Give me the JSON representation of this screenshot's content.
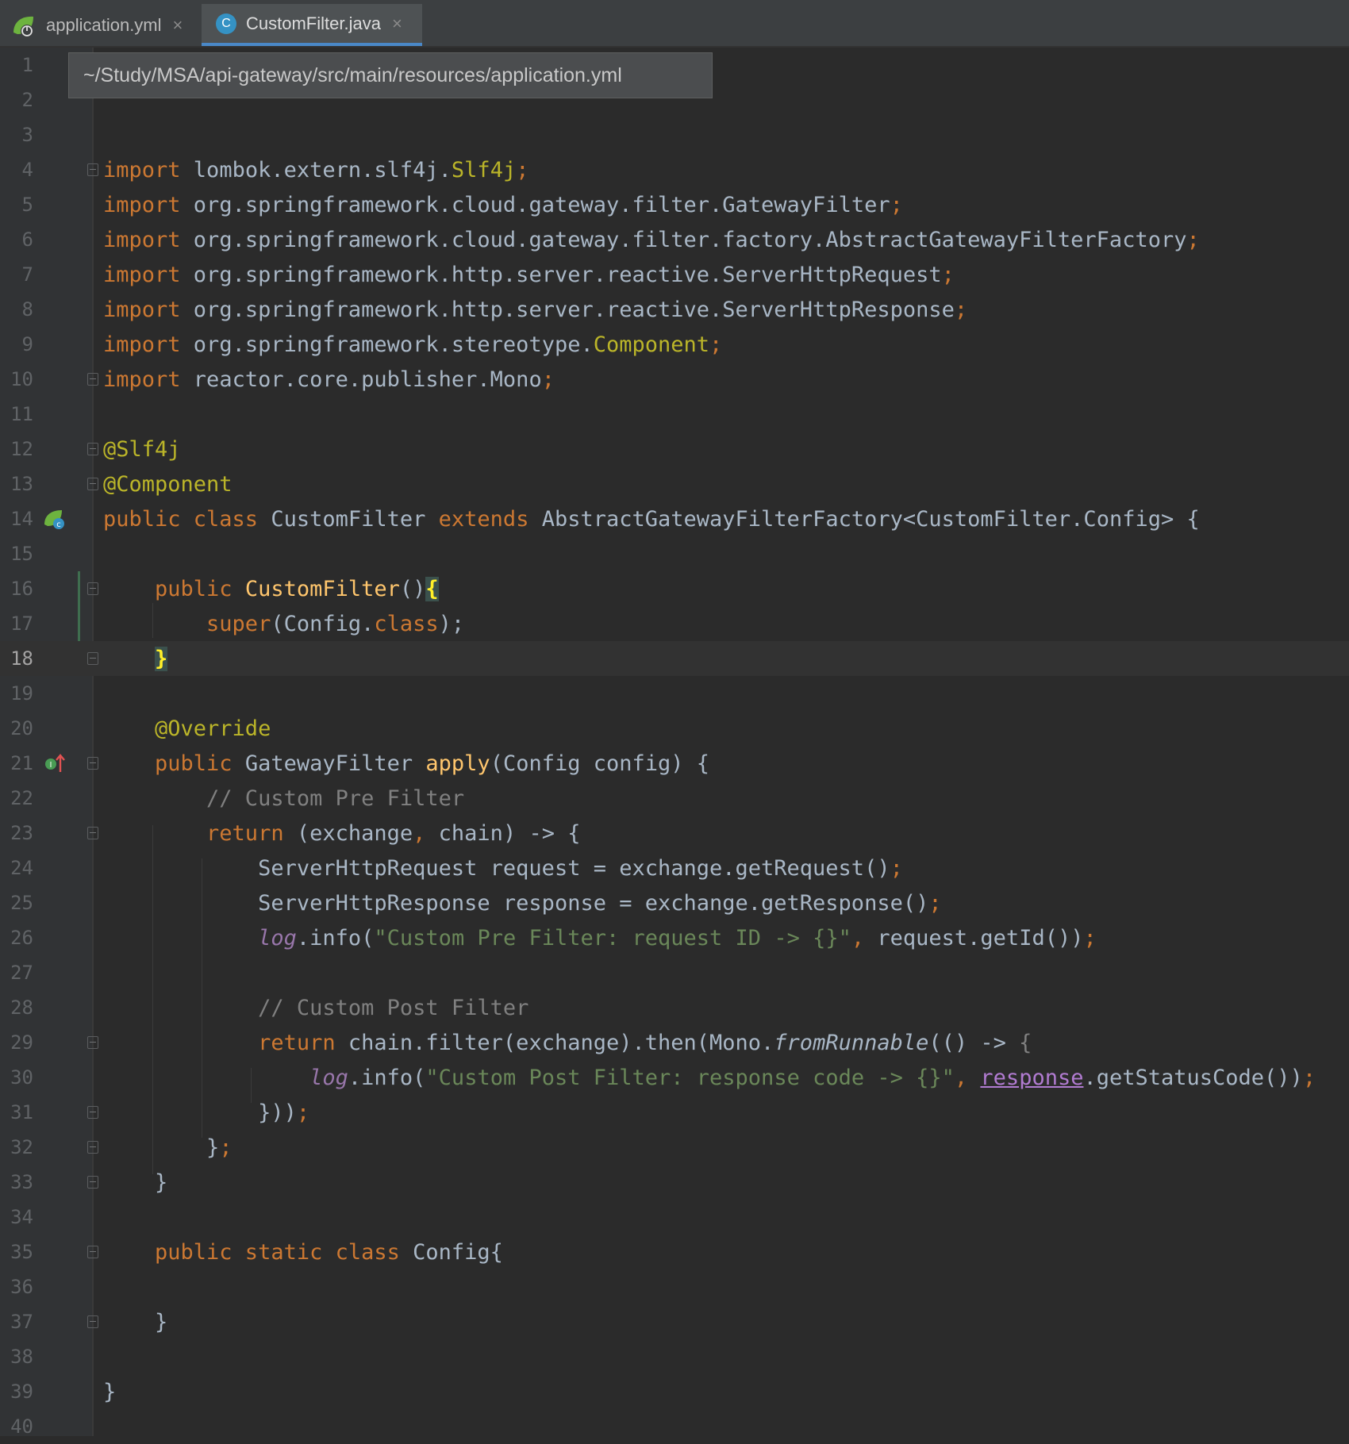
{
  "tabs": [
    {
      "label": "application.yml",
      "icon": "spring-boot-icon",
      "active": false
    },
    {
      "label": "CustomFilter.java",
      "icon": "java-class-icon",
      "active": true
    }
  ],
  "tooltip": "~/Study/MSA/api-gateway/src/main/resources/application.yml",
  "current_line": 18,
  "lines": [
    "1",
    "2",
    "3",
    "4",
    "5",
    "6",
    "7",
    "8",
    "9",
    "10",
    "11",
    "12",
    "13",
    "14",
    "15",
    "16",
    "17",
    "18",
    "19",
    "20",
    "21",
    "22",
    "23",
    "24",
    "25",
    "26",
    "27",
    "28",
    "29",
    "30",
    "31",
    "32",
    "33",
    "34",
    "35",
    "36",
    "37",
    "38",
    "39",
    "40"
  ],
  "code": {
    "l4a": "import",
    "l4b": " lombok.extern.slf4j.",
    "l4c": "Slf4j",
    "l4d": ";",
    "l5a": "import",
    "l5b": " org.springframework.cloud.gateway.filter.GatewayFilter",
    "l5d": ";",
    "l6a": "import",
    "l6b": " org.springframework.cloud.gateway.filter.factory.AbstractGatewayFilterFactory",
    "l6d": ";",
    "l7a": "import",
    "l7b": " org.springframework.http.server.reactive.ServerHttpRequest",
    "l7d": ";",
    "l8a": "import",
    "l8b": " org.springframework.http.server.reactive.ServerHttpResponse",
    "l8d": ";",
    "l9a": "import",
    "l9b": " org.springframework.stereotype.",
    "l9c": "Component",
    "l9d": ";",
    "l10a": "import",
    "l10b": " reactor.core.publisher.Mono",
    "l10d": ";",
    "l12": "@Slf4j",
    "l13": "@Component",
    "l14a": "public class",
    "l14b": " CustomFilter ",
    "l14c": "extends",
    "l14d": " AbstractGatewayFilterFactory<CustomFilter.Config> {",
    "l16a": "    public ",
    "l16b": "CustomFilter",
    "l16c": "()",
    "l16d": "{",
    "l17a": "        super",
    "l17b": "(Config.",
    "l17c": "class",
    "l17d": ");",
    "l18a": "    ",
    "l18b": "}",
    "l20": "    @Override",
    "l21a": "    public",
    "l21b": " GatewayFilter ",
    "l21c": "apply",
    "l21d": "(Config config) {",
    "l22": "        // Custom Pre Filter",
    "l23a": "        return",
    "l23b": " (exchange",
    "l23c": ",",
    "l23d": " chain) -> {",
    "l24a": "            ServerHttpRequest request = exchange.getRequest()",
    "l24b": ";",
    "l25a": "            ServerHttpResponse response = exchange.getResponse()",
    "l25b": ";",
    "l26a": "            ",
    "l26b": "log",
    "l26c": ".info(",
    "l26d": "\"Custom Pre Filter: request ID -> {}\"",
    "l26e": ",",
    "l26f": " request.getId())",
    "l26g": ";",
    "l28": "            // Custom Post Filter",
    "l29a": "            return",
    "l29b": " chain.filter(exchange).then(Mono.",
    "l29c": "fromRunnable",
    "l29d": "(() -> ",
    "l29e": "{",
    "l30a": "                ",
    "l30b": "log",
    "l30c": ".info(",
    "l30d": "\"Custom Post Filter: response code -> {}\"",
    "l30e": ", ",
    "l30f": "response",
    "l30g": ".getStatusCode())",
    "l30h": ";",
    "l31a": "            }))",
    "l31b": ";",
    "l32a": "        }",
    "l32b": ";",
    "l33": "    }",
    "l35a": "    public static class",
    "l35b": " Config{",
    "l37": "    }",
    "l39": "}"
  },
  "colors": {
    "keyword": "#cc7832",
    "annotation": "#bbb529",
    "method": "#ffc66d",
    "string": "#6a8759",
    "comment": "#808080",
    "field": "#9876aa",
    "plain": "#a9b7c6",
    "background": "#2b2b2b"
  }
}
